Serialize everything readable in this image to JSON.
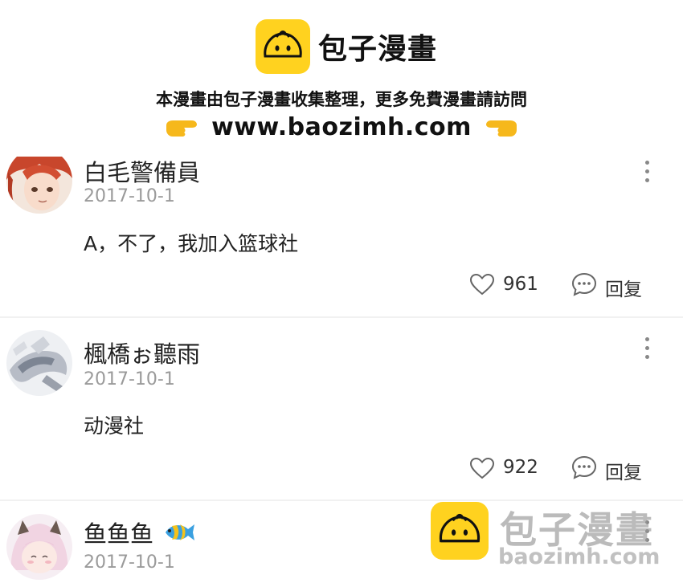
{
  "banner": {
    "logo_icon": "steamed-bun-icon",
    "brand": "包子漫畫",
    "notice": "本漫畫由包子漫畫收集整理，更多免費漫畫請訪問",
    "url": "www.baozimh.com",
    "accent": "#ffd21f"
  },
  "comments": [
    {
      "username": "白毛警備員",
      "date": "2017-10-1",
      "text": "A，不了，我加入篮球社",
      "likes": "961",
      "reply": "回复"
    },
    {
      "username": "楓橋ぉ聽雨",
      "date": "2017-10-1",
      "text": "动漫社",
      "likes": "922",
      "reply": "回复"
    },
    {
      "username": "鱼鱼鱼",
      "username_emoji": "tropical-fish-icon",
      "date": "2017-10-1"
    }
  ],
  "watermark": {
    "brand": "包子漫畫",
    "url": "baozimh.com"
  }
}
